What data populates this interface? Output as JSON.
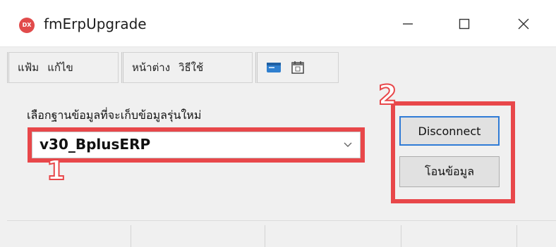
{
  "window": {
    "title": "fmErpUpgrade",
    "icon_text": "DX",
    "controls": {
      "minimize": "minimize-icon",
      "maximize": "maximize-icon",
      "close": "close-icon"
    }
  },
  "menu": {
    "items": [
      "แฟ้ม",
      "แก้ไข",
      "หน้าต่าง",
      "วิธีใช้"
    ],
    "toolbar_icons": [
      "window-icon",
      "calendar-icon"
    ]
  },
  "main": {
    "select_label": "เลือกฐานข้อมูลที่จะเก็บข้อมูลรุ่นใหม่",
    "database": {
      "selected": "v30_BplusERP"
    },
    "buttons": {
      "disconnect": "Disconnect",
      "transfer": "โอนข้อมูล"
    }
  },
  "annotations": {
    "step1": "1",
    "step2": "2",
    "highlight_color": "#e8474a"
  }
}
